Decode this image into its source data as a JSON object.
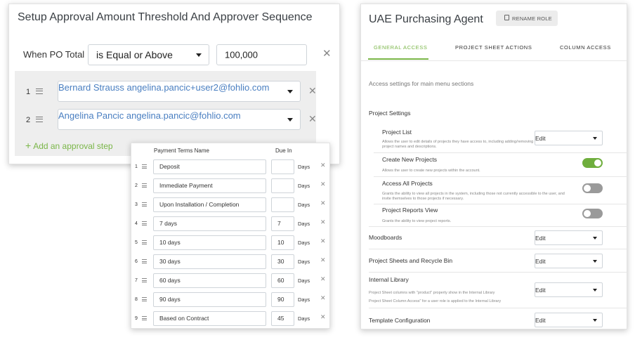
{
  "approval": {
    "title": "Setup Approval Amount Threshold And Approver Sequence",
    "when_label": "When PO Total",
    "operator": "is Equal or Above",
    "amount": "100,000",
    "approvers": [
      {
        "num": "1",
        "value": "Bernard Strauss angelina.pancic+user2@fohlio.com"
      },
      {
        "num": "2",
        "value": "Angelina Pancic angelina.pancic@fohlio.com"
      }
    ],
    "add_label": "Add an approval step",
    "accent": "#7ab648"
  },
  "payment_terms": {
    "header_name": "Payment Terms Name",
    "header_due": "Due In",
    "rows": [
      {
        "num": "1",
        "name": "Deposit",
        "due": "",
        "unit": "Days"
      },
      {
        "num": "2",
        "name": "Immediate Payment",
        "due": "",
        "unit": "Days"
      },
      {
        "num": "3",
        "name": "Upon Installation / Completion",
        "due": "",
        "unit": "Days"
      },
      {
        "num": "4",
        "name": "7 days",
        "due": "7",
        "unit": "Days"
      },
      {
        "num": "5",
        "name": "10 days",
        "due": "10",
        "unit": "Days"
      },
      {
        "num": "6",
        "name": "30 days",
        "due": "30",
        "unit": "Days"
      },
      {
        "num": "7",
        "name": "60 days",
        "due": "60",
        "unit": "Days"
      },
      {
        "num": "8",
        "name": "90 days",
        "due": "90",
        "unit": "Days"
      },
      {
        "num": "9",
        "name": "Based on Contract",
        "due": "45",
        "unit": "Days"
      }
    ]
  },
  "role": {
    "title": "UAE Purchasing Agent",
    "rename_label": "RENAME ROLE",
    "tabs": [
      "GENERAL ACCESS",
      "PROJECT SHEET ACTIONS",
      "COLUMN ACCESS"
    ],
    "active_tab": "GENERAL ACCESS",
    "intro": "Access settings for main menu sections",
    "project_settings": {
      "title": "Project Settings",
      "project_list": {
        "name": "Project List",
        "desc": "Allows the user to edit details of projects they have access to, including adding/removing users and updating project names and descriptions.",
        "value": "Edit"
      },
      "create_new": {
        "name": "Create New Projects",
        "desc": "Allows the user to create new projects within the account.",
        "enabled": true
      },
      "access_all": {
        "name": "Access All Projects",
        "desc": "Grants the ability to view all projects in the system, including those not currently accessible to the user, and invite themselves to those projects if necessary.",
        "enabled": false
      },
      "reports_view": {
        "name": "Project Reports View",
        "desc": "Grants the ability to view project reports.",
        "enabled": false
      }
    },
    "moodboards": {
      "title": "Moodboards",
      "value": "Edit"
    },
    "sheets_bin": {
      "title": "Project Sheets and Recycle Bin",
      "value": "Edit"
    },
    "internal_library": {
      "title": "Internal Library",
      "note1": "Project Sheet columns with \"product\" property show in the Internal Library",
      "note2": "Project Sheet Column Access\" for a user role is applied to the Internal Library",
      "value": "Edit"
    },
    "template_config": {
      "title": "Template Configuration",
      "value": "Edit"
    },
    "toggle_on_color": "#6fae3d",
    "toggle_off_color": "#9a9a9a"
  }
}
